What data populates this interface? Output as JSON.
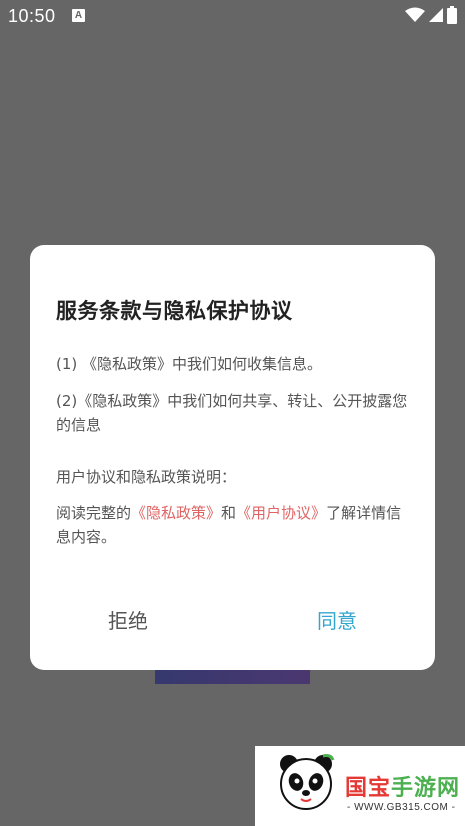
{
  "status_bar": {
    "time": "10:50",
    "notification_icon": "a-icon",
    "right_icons": [
      "wifi-icon",
      "signal-icon",
      "battery-icon"
    ]
  },
  "dialog": {
    "title": "服务条款与隐私保护协议",
    "line1": "(1) 《隐私政策》中我们如何收集信息。",
    "line2": "(2)《隐私政策》中我们如何共享、转让、公开披露您的信息",
    "line3": "用户协议和隐私政策说明：",
    "line4_prefix": "阅读完整的",
    "line4_link1": "《隐私政策》",
    "line4_mid": "和",
    "line4_link2": "《用户协议》",
    "line4_suffix": "了解详情信息内容。",
    "reject_label": "拒绝",
    "agree_label": "同意"
  },
  "watermark": {
    "brand_part1": "国宝",
    "brand_part2": "手游网",
    "url": "- WWW.GB315.COM -"
  },
  "colors": {
    "overlay": "#666666",
    "link": "#e06464",
    "agree": "#33a6cf",
    "brand_red": "#e53935",
    "brand_green": "#4caf50"
  }
}
